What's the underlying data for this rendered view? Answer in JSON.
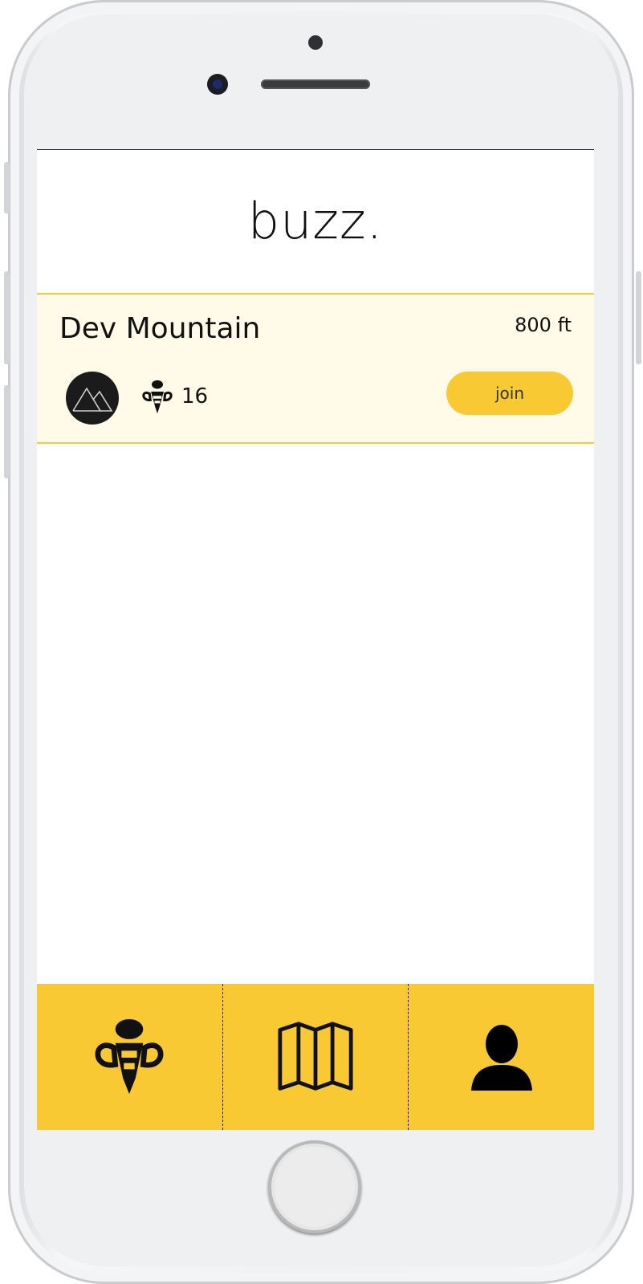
{
  "app": {
    "title": "buzz."
  },
  "hives": [
    {
      "name": "Dev Mountain",
      "distance": "800 ft",
      "member_count": "16",
      "join_label": "join",
      "avatar_icon": "mountain-icon",
      "members_icon": "bee-icon"
    }
  ],
  "tabbar": {
    "tabs": [
      {
        "name": "hives",
        "icon": "bee-icon"
      },
      {
        "name": "map",
        "icon": "map-icon"
      },
      {
        "name": "profile",
        "icon": "user-icon"
      }
    ]
  },
  "colors": {
    "accent": "#f9c934",
    "card_bg": "#fffbe8",
    "text": "#111111"
  }
}
